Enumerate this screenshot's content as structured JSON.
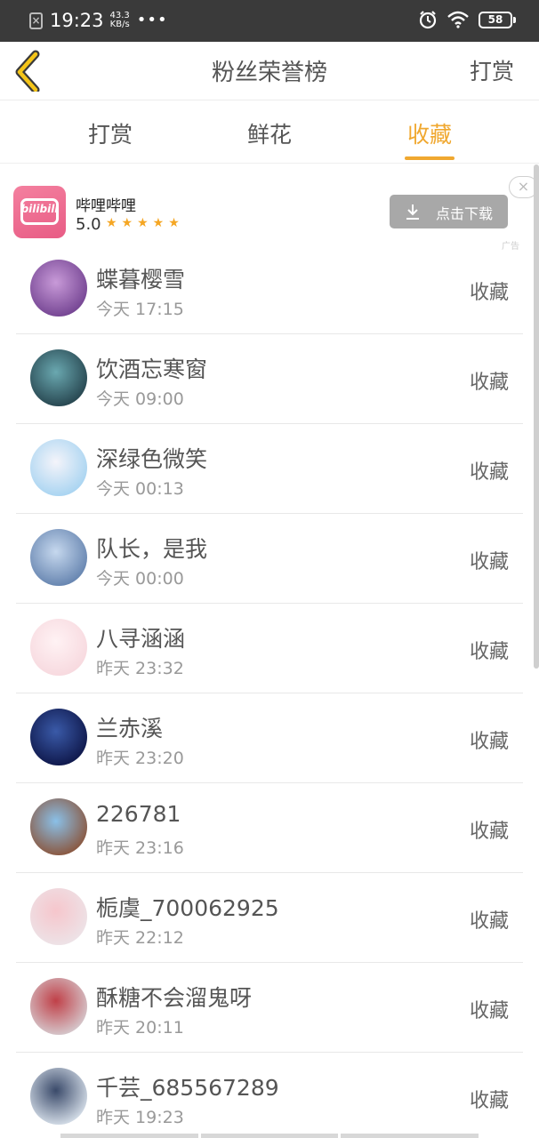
{
  "status_bar": {
    "time": "19:23",
    "net_speed_value": "43.3",
    "net_speed_unit": "KB/s",
    "dots": "•••",
    "battery": "58"
  },
  "header": {
    "title": "粉丝荣誉榜",
    "right_action": "打赏",
    "back_icon": "chevron-left-icon"
  },
  "tabs": [
    {
      "label": "打赏",
      "active": false
    },
    {
      "label": "鲜花",
      "active": false
    },
    {
      "label": "收藏",
      "active": true
    }
  ],
  "colors": {
    "accent": "#f0a830",
    "ad_brand": "#e85c85"
  },
  "ad": {
    "logo_text": "bilibili",
    "app_name": "哔哩哔哩",
    "rating": "5.0",
    "stars": "★★★★★",
    "download_label": "点击下载",
    "close_label": "×",
    "ad_label": "广告"
  },
  "list": [
    {
      "name": "蝶暮樱雪",
      "time": "今天 17:15",
      "action": "收藏",
      "avatar_colors": [
        "#6a3a8a",
        "#c89ad8"
      ]
    },
    {
      "name": "饮酒忘寒窗",
      "time": "今天 09:00",
      "action": "收藏",
      "avatar_colors": [
        "#1f3a44",
        "#6aa8b0"
      ]
    },
    {
      "name": "深绿色微笑",
      "time": "今天 00:13",
      "action": "收藏",
      "avatar_colors": [
        "#9fd0f0",
        "#f4f4fa"
      ]
    },
    {
      "name": "队长，是我",
      "time": "今天 00:00",
      "action": "收藏",
      "avatar_colors": [
        "#5a7aa8",
        "#c6d8ee"
      ]
    },
    {
      "name": "八寻涵涵",
      "time": "昨天 23:32",
      "action": "收藏",
      "avatar_colors": [
        "#f6d6dc",
        "#fff2f4"
      ]
    },
    {
      "name": "兰赤溪",
      "time": "昨天 23:20",
      "action": "收藏",
      "avatar_colors": [
        "#0a1040",
        "#3a5aa8"
      ]
    },
    {
      "name": "226781",
      "time": "昨天 23:16",
      "action": "收藏",
      "avatar_colors": [
        "#8a4a2a",
        "#8ac0e8"
      ]
    },
    {
      "name": "栀虞_700062925",
      "time": "昨天 22:12",
      "action": "收藏",
      "avatar_colors": [
        "#ece6ea",
        "#f6c6cc"
      ]
    },
    {
      "name": "酥糖不会溜鬼呀",
      "time": "昨天 20:11",
      "action": "收藏",
      "avatar_colors": [
        "#d8d8dc",
        "#c04048"
      ]
    },
    {
      "name": "千芸_685567289",
      "time": "昨天 19:23",
      "action": "收藏",
      "avatar_colors": [
        "#e6eef6",
        "#3a4a6a"
      ]
    }
  ]
}
